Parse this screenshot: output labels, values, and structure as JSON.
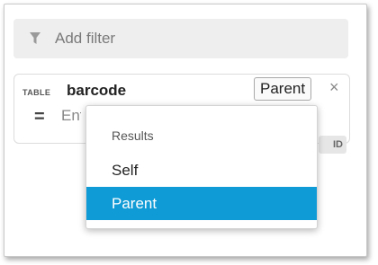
{
  "filter_bar": {
    "add_filter_label": "Add filter",
    "icon": "funnel-icon"
  },
  "condition": {
    "tag": "TABLE",
    "table_name": "barcode",
    "operator_button": "Parent",
    "close_icon": "close-icon",
    "comparator": "=",
    "value_partial": "Ent",
    "badge_partial": "ID"
  },
  "dropdown": {
    "header": "Results",
    "items": [
      {
        "label": "Self",
        "selected": false
      },
      {
        "label": "Parent",
        "selected": true
      }
    ]
  },
  "colors": {
    "selected_bg": "#0f9bd6",
    "filter_bar_bg": "#eeeeee"
  }
}
